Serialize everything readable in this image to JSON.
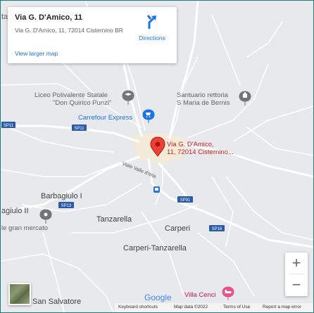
{
  "info_card": {
    "title": "Via G. D'Amico, 11",
    "address": "Via G. D'Amico, 11, 72014 Cisternino BR",
    "view_larger_map": "View larger map",
    "directions": "Directions"
  },
  "marker": {
    "label_line1": "Via G. D'Amico,",
    "label_line2": "11, 72014 Cisternino..."
  },
  "places": {
    "liceo_line1": "Liceo Polivalente Statale",
    "liceo_line2": "\"Don Quirico Punzi\"",
    "santuario_line1": "Santuario rettoria",
    "santuario_line2": "S Maria de Bernis",
    "carrefour": "Carrefour Express",
    "bagiulo_1": "Barbagiulo I",
    "bagiulo_2": "agiulo II",
    "gran_mercato": "le gran mercato",
    "tanzarella": "Tanzarella",
    "carperi": "Carperi",
    "carperi_tanzarella": "Carperi-Tanzarella",
    "san_salvatore": "San Salvatore",
    "villa_cenci": "Villa Cenci",
    "left_edge": "ta",
    "via_valle_ditria": "Viale Valle d'Itria"
  },
  "road_shields": {
    "sp11_left": "SP11",
    "sp11": "SP11",
    "sp13": "SP13",
    "sp91": "SP91",
    "sp16": "SP16"
  },
  "controls": {
    "zoom_in": "+",
    "zoom_out": "−"
  },
  "branding": {
    "google": "Google"
  },
  "attribution": {
    "keyboard_shortcuts": "Keyboard shortcuts",
    "map_data": "Map data ©2022",
    "terms": "Terms of Use",
    "report": "Report a map error"
  },
  "colors": {
    "water_green": "#1f7a7a",
    "map_bg": "#e8e9ec",
    "road": "#ffffff",
    "urban": "#f4ead8",
    "marker_red": "#ea4335",
    "marker_text": "#c5221f",
    "poi_gray": "#70757a",
    "poi_blue": "#1a73e8",
    "poi_pink": "#e8528f",
    "link_blue": "#1a73e8"
  }
}
